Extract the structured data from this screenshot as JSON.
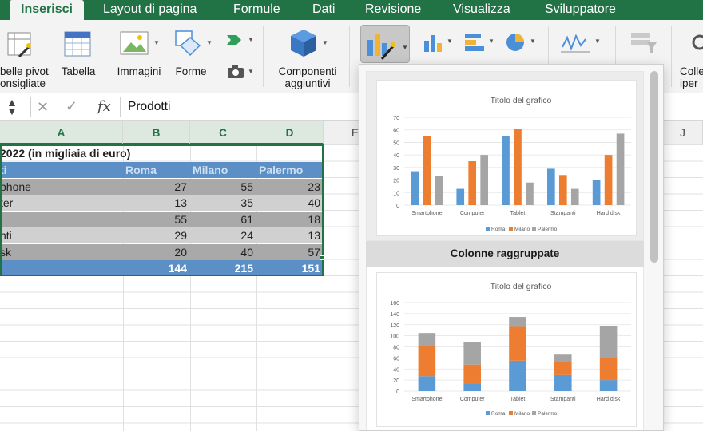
{
  "ribbon_tabs": [
    "Inserisci",
    "Layout di pagina",
    "Formule",
    "Dati",
    "Revisione",
    "Visualizza",
    "Sviluppatore"
  ],
  "ribbon": {
    "pivot_label_line1": "belle pivot",
    "pivot_label_line2": "onsigliate",
    "table_label": "Tabella",
    "images_label": "Immagini",
    "shapes_label": "Forme",
    "addins_label_line1": "Componenti",
    "addins_label_line2": "aggiuntivi",
    "links_label_line1": "Colle",
    "links_label_line2": "iper"
  },
  "formula_bar": {
    "value": "Prodotti",
    "fx_label": "fx"
  },
  "columns": [
    "A",
    "B",
    "C",
    "D",
    "E",
    "J"
  ],
  "sheet": {
    "title": "2022 (in migliaia di euro)",
    "header": [
      "ti",
      "Roma",
      "Milano",
      "Palermo"
    ],
    "rows": [
      [
        "phone",
        "27",
        "55",
        "23"
      ],
      [
        "ter",
        "13",
        "35",
        "40"
      ],
      [
        "",
        "55",
        "61",
        "18"
      ],
      [
        "nti",
        "29",
        "24",
        "13"
      ],
      [
        "sk",
        "20",
        "40",
        "57"
      ]
    ],
    "total": [
      "l",
      "144",
      "215",
      "151"
    ]
  },
  "dropdown": {
    "caption": "Colonne raggruppate",
    "charts": [
      {
        "title": "Titolo del grafico",
        "type": "bar",
        "ylim": [
          0,
          70
        ],
        "yticks": [
          "0",
          "10",
          "20",
          "30",
          "40",
          "50",
          "60",
          "70"
        ],
        "categories": [
          "Smartphone",
          "Computer",
          "Tablet",
          "Stampanti",
          "Hard disk"
        ],
        "series": [
          {
            "name": "Roma",
            "values": [
              27,
              13,
              55,
              29,
              20
            ],
            "color": "#5b9bd5"
          },
          {
            "name": "Milano",
            "values": [
              55,
              35,
              61,
              24,
              40
            ],
            "color": "#ed7d31"
          },
          {
            "name": "Palermo",
            "values": [
              23,
              40,
              18,
              13,
              57
            ],
            "color": "#a5a5a5"
          }
        ]
      },
      {
        "title": "Titolo del grafico",
        "type": "stacked-bar",
        "ylim": [
          0,
          160
        ],
        "yticks": [
          "0",
          "20",
          "40",
          "60",
          "80",
          "100",
          "120",
          "140",
          "160"
        ],
        "categories": [
          "Smartphone",
          "Computer",
          "Tablet",
          "Stampanti",
          "Hard disk"
        ],
        "series": [
          {
            "name": "Roma",
            "values": [
              27,
              13,
              55,
              29,
              20
            ],
            "color": "#5b9bd5"
          },
          {
            "name": "Milano",
            "values": [
              55,
              35,
              61,
              24,
              40
            ],
            "color": "#ed7d31"
          },
          {
            "name": "Palermo",
            "values": [
              23,
              40,
              18,
              13,
              57
            ],
            "color": "#a5a5a5"
          }
        ]
      }
    ]
  },
  "chart_data": [
    {
      "type": "bar",
      "title": "Titolo del grafico",
      "categories": [
        "Smartphone",
        "Computer",
        "Tablet",
        "Stampanti",
        "Hard disk"
      ],
      "series": [
        {
          "name": "Roma",
          "values": [
            27,
            13,
            55,
            29,
            20
          ]
        },
        {
          "name": "Milano",
          "values": [
            55,
            35,
            61,
            24,
            40
          ]
        },
        {
          "name": "Palermo",
          "values": [
            23,
            40,
            18,
            13,
            57
          ]
        }
      ],
      "ylim": [
        0,
        70
      ],
      "grid": true,
      "legend": "bottom"
    },
    {
      "type": "bar",
      "stacked": true,
      "title": "Titolo del grafico",
      "categories": [
        "Smartphone",
        "Computer",
        "Tablet",
        "Stampanti",
        "Hard disk"
      ],
      "series": [
        {
          "name": "Roma",
          "values": [
            27,
            13,
            55,
            29,
            20
          ]
        },
        {
          "name": "Milano",
          "values": [
            55,
            35,
            61,
            24,
            40
          ]
        },
        {
          "name": "Palermo",
          "values": [
            23,
            40,
            18,
            13,
            57
          ]
        }
      ],
      "ylim": [
        0,
        160
      ],
      "grid": true,
      "legend": "bottom"
    }
  ],
  "colors": {
    "excel_green": "#217346",
    "table_blue": "#5b8fc6",
    "roma": "#5b9bd5",
    "milano": "#ed7d31",
    "palermo": "#a5a5a5"
  }
}
